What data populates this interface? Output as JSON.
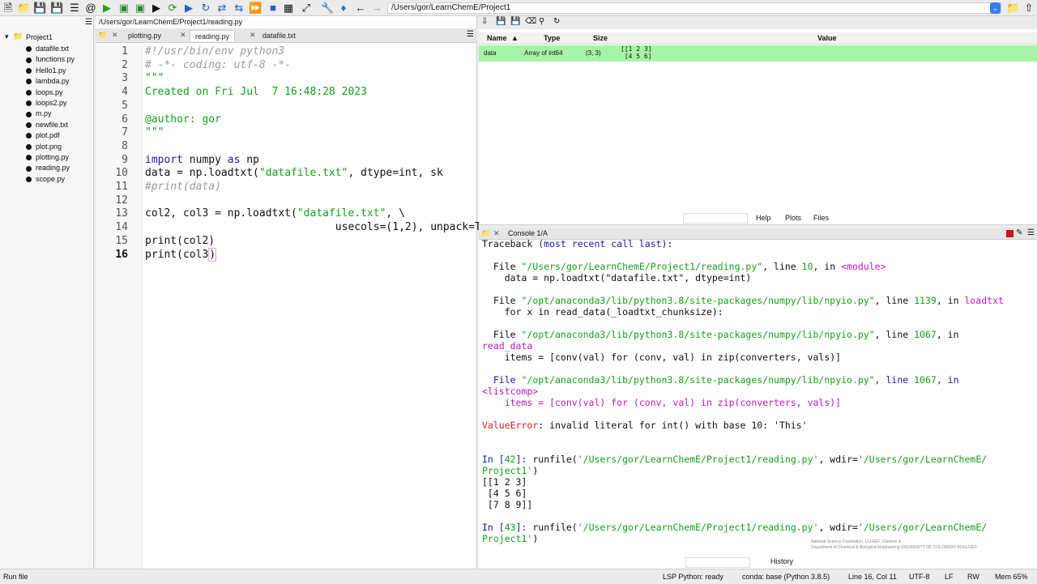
{
  "toolbar": {
    "path": "/Users/gor/LearnChemE/Project1",
    "icons": [
      "new-file-icon",
      "open-folder-icon",
      "save-icon",
      "save-all-icon",
      "list-icon",
      "at-icon",
      "run-icon",
      "run-cell-icon",
      "run-cell-advance-icon",
      "run-selection-icon",
      "debug-icon",
      "reload-icon",
      "stop-icon",
      "maximize-icon",
      "wrench-icon",
      "python-icon",
      "back-arrow-icon",
      "forward-arrow-icon"
    ]
  },
  "files": {
    "project": "Project1",
    "items": [
      "datafile.txt",
      "functions.py",
      "Hello1.py",
      "lambda.py",
      "loops.py",
      "loops2.py",
      "m.py",
      "newfile.txt",
      "plot.pdf",
      "plot.png",
      "plotting.py",
      "reading.py",
      "scope.py"
    ]
  },
  "editor": {
    "path": "/Users/gor/LearnChemE/Project1/reading.py",
    "tabs": [
      "plotting.py",
      "reading.py",
      "datafile.txt"
    ],
    "active_tab": "reading.py",
    "line_numbers": [
      "1",
      "2",
      "3",
      "4",
      "5",
      "6",
      "7",
      "8",
      "9",
      "10",
      "11",
      "12",
      "13",
      "14",
      "15",
      "16"
    ],
    "current_line": "16"
  },
  "variables": {
    "headers": {
      "name": "Name",
      "type": "Type",
      "size": "Size",
      "value": "Value"
    },
    "row": {
      "name": "data",
      "type": "Array of int64",
      "size": "(3, 3)",
      "value_l1": "[[1 2 3]",
      "value_l2": " [4 5 6]"
    },
    "tabs": [
      "Help",
      "Plots",
      "Files"
    ]
  },
  "console": {
    "tab": "Console 1/A",
    "history_tab": "History"
  },
  "status": {
    "left": "Run file",
    "lsp": "LSP Python: ready",
    "conda": "conda: base (Python 3.8.5)",
    "position": "Line 16, Col 11",
    "encoding": "UTF-8",
    "eol": "LF",
    "perm": "RW",
    "mem": "Mem 65%"
  },
  "watermark": {
    "line1": "National Science Foundation, CU-EEF, Chevron &",
    "line2": "Department of Chemical & Biological Engineering  UNIVERSITY OF COLORADO BOULDER"
  },
  "colors": {
    "keyword": "#1a1aa6",
    "string": "#14a01c",
    "comment": "#9b9b9b",
    "highlight": "#a6f5a6",
    "error": "#d22222"
  }
}
